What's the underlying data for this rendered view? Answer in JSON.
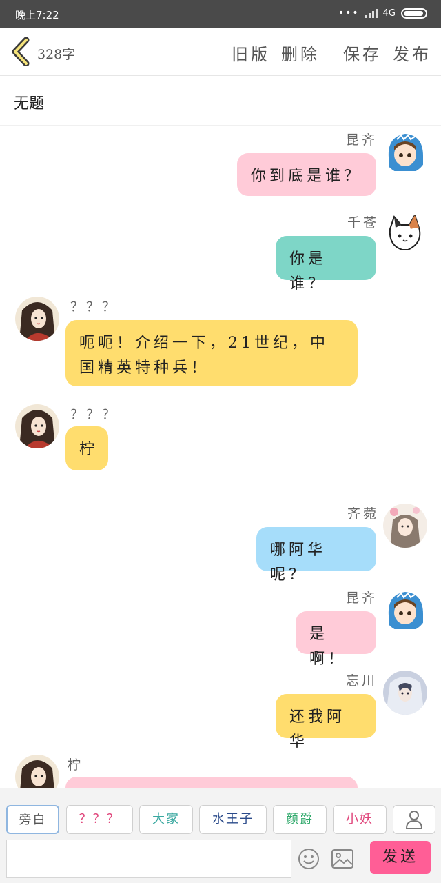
{
  "status_bar": {
    "time": "晚上7:22",
    "network": "4G"
  },
  "toolbar": {
    "word_count": "328字",
    "old_version": "旧版",
    "delete": "删除",
    "save": "保存",
    "publish": "发布"
  },
  "title": "无题",
  "messages": [
    {
      "name": "昆齐",
      "text": "你到底是谁？",
      "side": "right"
    },
    {
      "name": "千苍",
      "text": "你是谁？",
      "side": "right"
    },
    {
      "name": "？？？",
      "text": "呃呃！介绍一下，21世纪，中国精英特种兵！",
      "side": "left"
    },
    {
      "name": "？？？",
      "text": "柠",
      "side": "left"
    },
    {
      "name": "齐菀",
      "text": "哪阿华呢？",
      "side": "right"
    },
    {
      "name": "昆齐",
      "text": "是啊！",
      "side": "right"
    },
    {
      "name": "忘川",
      "text": "还我阿华",
      "side": "right"
    },
    {
      "name": "柠",
      "text": "",
      "side": "left"
    }
  ],
  "characters": [
    "旁白",
    "？？？",
    "大家",
    "水王子",
    "颜爵",
    "小妖"
  ],
  "colors": {
    "pink": "#ffcbd8",
    "teal": "#7ed6c7",
    "yellow": "#ffdd6e",
    "blue": "#a6ddfa",
    "send": "#ff5e96"
  },
  "input": {
    "placeholder": ""
  },
  "send_label": "发送"
}
